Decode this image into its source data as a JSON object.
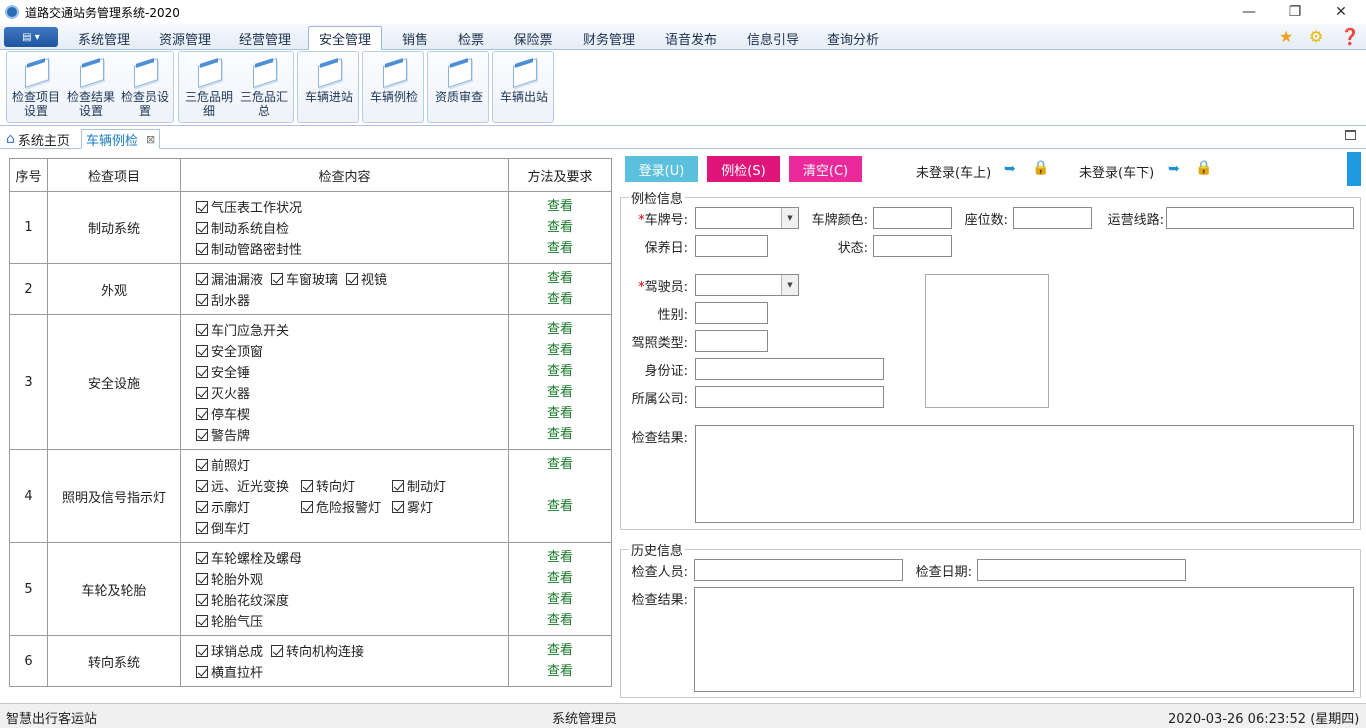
{
  "window": {
    "title": "道路交通站务管理系统-2020"
  },
  "menu": {
    "tabs": [
      "系统管理",
      "资源管理",
      "经营管理",
      "安全管理",
      "销售",
      "检票",
      "保险票",
      "财务管理",
      "语音发布",
      "信息引导",
      "查询分析"
    ],
    "active": "安全管理"
  },
  "ribbon": {
    "groups": [
      [
        "检查项目设置",
        "检查结果设置",
        "检查员设置"
      ],
      [
        "三危品明细",
        "三危品汇总"
      ],
      [
        "车辆进站"
      ],
      [
        "车辆例检"
      ],
      [
        "资质审查"
      ],
      [
        "车辆出站"
      ]
    ]
  },
  "doc_tabs": {
    "home": "系统主页",
    "active": "车辆例检"
  },
  "checklist": {
    "headers": [
      "序号",
      "检查项目",
      "检查内容",
      "方法及要求"
    ],
    "view_label": "查看",
    "rows": [
      {
        "no": "1",
        "item": "制动系统",
        "lines": [
          [
            "气压表工作状况"
          ],
          [
            "制动系统自检"
          ],
          [
            "制动管路密封性"
          ]
        ],
        "views": [
          1,
          1,
          1
        ]
      },
      {
        "no": "2",
        "item": "外观",
        "lines": [
          [
            "漏油漏液",
            "车窗玻璃",
            "视镜"
          ],
          [
            "刮水器"
          ]
        ],
        "views": [
          1,
          1
        ]
      },
      {
        "no": "3",
        "item": "安全设施",
        "lines": [
          [
            "车门应急开关"
          ],
          [
            "安全顶窗"
          ],
          [
            "安全锤"
          ],
          [
            "灭火器"
          ],
          [
            "停车楔"
          ],
          [
            "警告牌"
          ]
        ],
        "views": [
          1,
          1,
          1,
          1,
          1,
          1
        ]
      },
      {
        "no": "4",
        "item": "照明及信号指示灯",
        "lines": [
          [
            "前照灯"
          ],
          [
            "远、近光变换",
            "转向灯",
            "制动灯"
          ],
          [
            "示廓灯",
            "危险报警灯",
            "雾灯"
          ],
          [
            "倒车灯"
          ]
        ],
        "views": [
          1,
          0,
          1,
          0
        ]
      },
      {
        "no": "5",
        "item": "车轮及轮胎",
        "lines": [
          [
            "车轮螺栓及螺母"
          ],
          [
            "轮胎外观"
          ],
          [
            "轮胎花纹深度"
          ],
          [
            "轮胎气压"
          ]
        ],
        "views": [
          1,
          1,
          1,
          1
        ]
      },
      {
        "no": "6",
        "item": "转向系统",
        "lines": [
          [
            "球销总成",
            "转向机构连接"
          ],
          [
            "横直拉杆"
          ]
        ],
        "views": [
          1,
          1
        ]
      }
    ]
  },
  "toolbar": {
    "login": "登录(U)",
    "inspect": "例检(S)",
    "clear": "清空(C)",
    "status_on": "未登录(车上)",
    "status_off": "未登录(车下)",
    "colors": {
      "login": "#5bc0de",
      "inspect": "#e0157a",
      "clear": "#ea2a9a"
    }
  },
  "inspection_info": {
    "legend": "例检信息",
    "plate": "车牌号:",
    "plate_color": "车牌颜色:",
    "seats": "座位数:",
    "route": "运营线路:",
    "maintenance": "保养日:",
    "status": "状态:",
    "driver": "驾驶员:",
    "gender": "性别:",
    "license_type": "驾照类型:",
    "id_card": "身份证:",
    "company": "所属公司:",
    "result": "检查结果:"
  },
  "history": {
    "legend": "历史信息",
    "inspector": "检查人员:",
    "date": "检查日期:",
    "result": "检查结果:"
  },
  "statusbar": {
    "station": "智慧出行客运站",
    "user": "系统管理员",
    "datetime": "2020-03-26 06:23:52 (星期四)"
  }
}
